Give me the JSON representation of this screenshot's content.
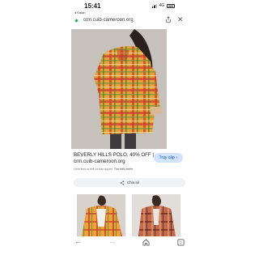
{
  "status_bar": {
    "time": "15:41",
    "back_app": "◂ Safari",
    "network": "4G"
  },
  "url_bar": {
    "icon": "site-favicon",
    "url": "crm.cuib-cameroon.org",
    "share_icon": "share-icon",
    "close_icon": "close-icon"
  },
  "result": {
    "title": "BEVERLY HILLS POLO, 40% OFF | crm.cuib-cameroon.org",
    "note": "Hình ảnh có thể có bản quyền.",
    "note_link": "Tìm hiểu thêm",
    "visit_label": "Truy cập",
    "share_label": "Chia sẻ"
  },
  "nav": {
    "back_icon": "back-arrow-icon",
    "forward_icon": "forward-arrow-icon",
    "home_icon": "home-icon",
    "tabs_icon": "tabs-icon"
  }
}
